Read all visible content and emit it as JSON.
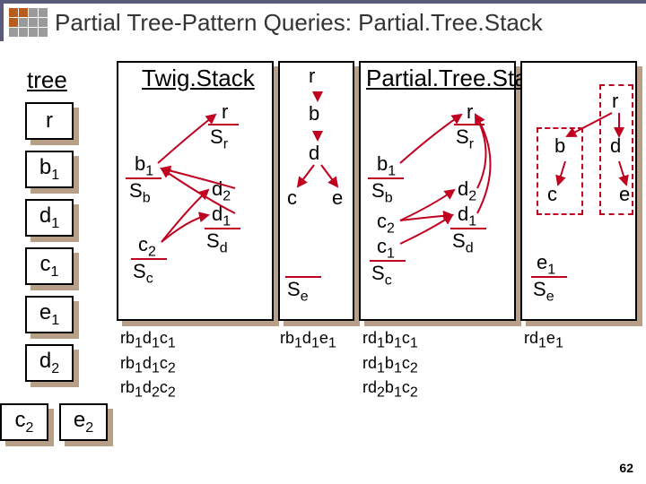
{
  "title": "Partial Tree-Pattern Queries: Partial.Tree.Stack",
  "tree_label": "tree",
  "tree_nodes": [
    "r",
    "b1",
    "d1",
    "c1",
    "e1",
    "d2",
    "c2",
    "e2"
  ],
  "twig": {
    "title": "Twig.Stack",
    "Sr": "Sr",
    "Sb": "Sb",
    "Sc": "Sc",
    "Sd": "Sd",
    "Se": "Se",
    "r": "r",
    "b1": "b1",
    "c2": "c2",
    "d2": "d2",
    "d1": "d1",
    "paths": [
      "rb1d1c1",
      "rb1d1c2",
      "rb1d2c2"
    ]
  },
  "qtree": {
    "r": "r",
    "b": "b",
    "d": "d",
    "c": "c",
    "e": "e"
  },
  "qpaths": [
    "rb1d1e1"
  ],
  "pts": {
    "title": "Partial.Tree.Stack",
    "Sr": "Sr",
    "Sb": "Sb",
    "Sc": "Sc",
    "Sd": "Sd",
    "Se": "Se",
    "r": "r",
    "b1": "b1",
    "c2": "c2",
    "c1": "c1",
    "d2": "d2",
    "d1": "d1",
    "e1": "e1",
    "paths": [
      "rd1b1c1",
      "rd1b1c2",
      "rd2b1c2"
    ],
    "paths2": [
      "rd1e1"
    ]
  },
  "ptree": {
    "r": "r",
    "b": "b",
    "d": "d",
    "c": "c",
    "e": "e"
  },
  "pageno": "62"
}
